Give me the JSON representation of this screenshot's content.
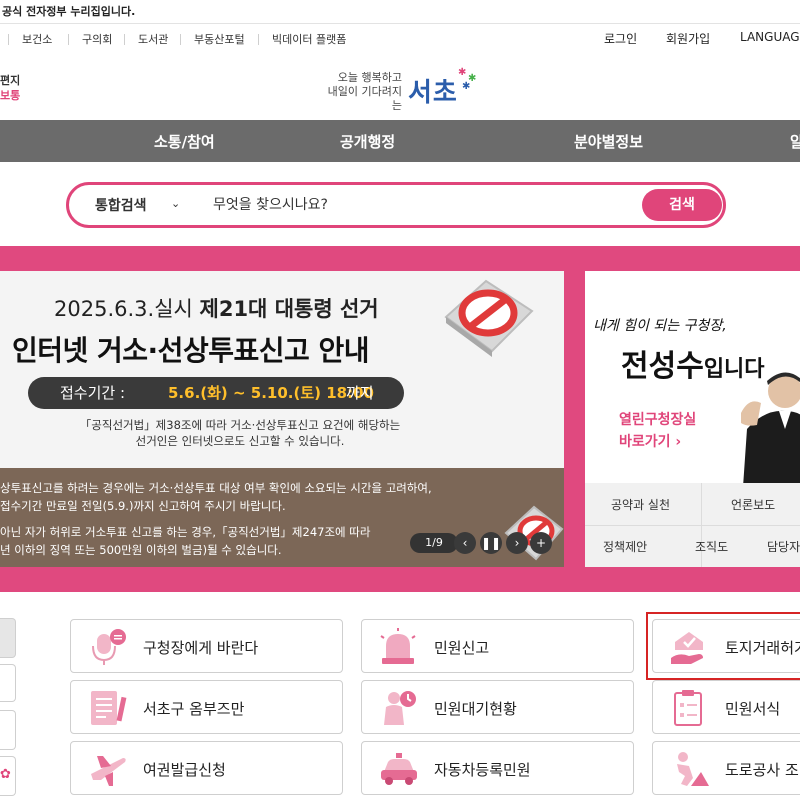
{
  "gov_banner": "공식 전자정부 누리집입니다.",
  "util_nav": {
    "links": [
      "보건소",
      "구의회",
      "도서관",
      "부동산포털",
      "빅데이터 플랫폼"
    ],
    "login": "로그인",
    "signup": "회원가입",
    "language": "LANGUAGE"
  },
  "header": {
    "logo_left_line1": "편지",
    "logo_left_line2": "보통",
    "slogan_line1": "오늘 행복하고",
    "slogan_line2": "내일이 기다려지는",
    "brand": "서초"
  },
  "nav": [
    "소통/참여",
    "공개행정",
    "분야별정보",
    "알"
  ],
  "search": {
    "category": "통합검색",
    "placeholder": "무엇을 찾으시나요?",
    "button": "검색"
  },
  "banner": {
    "title1_prefix": "2025.6.3.실시 ",
    "title1_bold": "제21대 대통령 선거",
    "title2": "인터넷 거소·선상투표신고 안내",
    "period_label": "접수기간 :",
    "period_date": "5.6.(화) ~ 5.10.(토) 18:00",
    "period_suffix": "까지",
    "desc_line1": "「공직선거법」제38조에 따라 거소·선상투표신고 요건에 해당하는",
    "desc_line2": "선거인은 인터넷으로도 신고할 수 있습니다.",
    "notice_line1": "상투표신고를 하려는 경우에는 거소·선상투표 대상 여부 확인에 소요되는 시간을 고려하여,",
    "notice_line2": "접수기간 만료일 전일(5.9.)까지 신고하여 주시기 바랍니다.",
    "notice_line3": "아닌 자가 허위로 거소투표 신고를 하는 경우,「공직선거법」제247조에 따라",
    "notice_line4": "년 이하의 징역 또는 500만원 이하의 벌금)될 수 있습니다.",
    "counter": "1/9"
  },
  "mayor": {
    "tagline": "내게 힘이 되는 구청장,",
    "name": "전성수",
    "name_suffix": "입니다",
    "link_line1": "열린구청장실",
    "link_line2": "바로가기 ›",
    "tabs": [
      "공약과 실천",
      "언론보도",
      "정책제안",
      "조직도",
      "담당자"
    ]
  },
  "services": [
    {
      "label": "구청장에게 바란다",
      "icon": "microphone-icon"
    },
    {
      "label": "민원신고",
      "icon": "siren-icon"
    },
    {
      "label": "토지거래허가",
      "icon": "land-permit-icon"
    },
    {
      "label": "서초구 옴부즈만",
      "icon": "document-pen-icon"
    },
    {
      "label": "민원대기현황",
      "icon": "waiting-person-icon"
    },
    {
      "label": "민원서식",
      "icon": "clipboard-icon"
    },
    {
      "label": "여권발급신청",
      "icon": "airplane-icon"
    },
    {
      "label": "자동차등록민원",
      "icon": "car-icon"
    },
    {
      "label": "도로공사 조",
      "icon": "road-work-icon"
    }
  ],
  "colors": {
    "accent_pink": "#e0457a",
    "nav_gray": "#6b6b6b",
    "highlight_red": "#d62424",
    "banner_brown": "#7c6757",
    "pill_date_yellow": "#ffbf2b"
  }
}
